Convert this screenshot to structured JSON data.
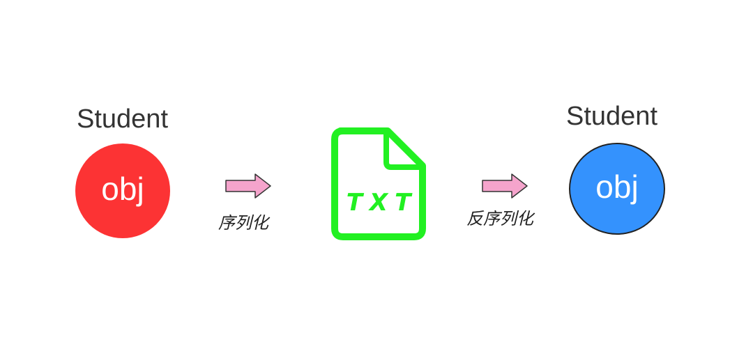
{
  "left": {
    "class_label": "Student",
    "object_text": "obj",
    "color": "#fc3334"
  },
  "serialize": {
    "label": "序列化",
    "arrow_color": "#f5a4cc",
    "icon": "right-arrow-icon"
  },
  "file": {
    "text": "TXT",
    "color": "#22f022",
    "icon": "txt-file-icon"
  },
  "deserialize": {
    "label": "反序列化",
    "arrow_color": "#f5a4cc",
    "icon": "right-arrow-icon"
  },
  "right": {
    "class_label": "Student",
    "object_text": "obj",
    "color": "#3492fd"
  }
}
